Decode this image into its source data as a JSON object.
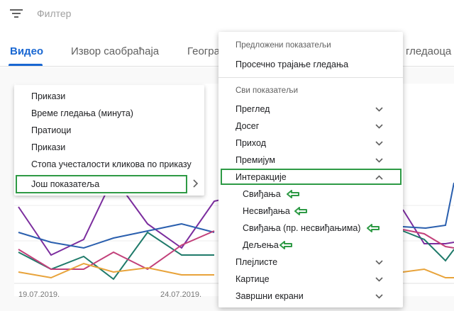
{
  "filter": {
    "placeholder": "Филтер",
    "icon": "filter-icon"
  },
  "tabs": [
    {
      "label": "Видео",
      "active": true
    },
    {
      "label": "Извор саобраћаја",
      "active": false
    },
    {
      "label": "Геогра",
      "active": false
    },
    {
      "label": "гледаоца",
      "active": false
    }
  ],
  "chart": {
    "x_labels": [
      "19.07.2019.",
      "24.07.2019."
    ],
    "colors": {
      "purple": "#7b2d9e",
      "blue": "#2a5fae",
      "teal": "#1f7a6a",
      "pink": "#c2407a",
      "orange": "#e8a33a"
    }
  },
  "left_menu": {
    "items": [
      "Прикази",
      "Време гледања (минута)",
      "Пратиоци",
      "Прикази",
      "Стопа учесталости кликова по приказу"
    ],
    "more": "Још показатеља"
  },
  "dropdown": {
    "suggested_header": "Предложени показатељи",
    "suggested_items": [
      "Просечно трајање гледања"
    ],
    "all_header": "Сви показатељи",
    "groups_top": [
      "Преглед",
      "Досег",
      "Приход",
      "Премијум"
    ],
    "interaction": {
      "label": "Интеракције",
      "items": [
        "Свиђања",
        "Несвиђања",
        "Свиђања (пр. несвиђањима)",
        "Дељења"
      ]
    },
    "groups_bottom": [
      "Плејлисте",
      "Картице",
      "Завршни екрани"
    ]
  },
  "accent": {
    "highlight": "#2e9a45",
    "active_tab": "#1967d2"
  }
}
